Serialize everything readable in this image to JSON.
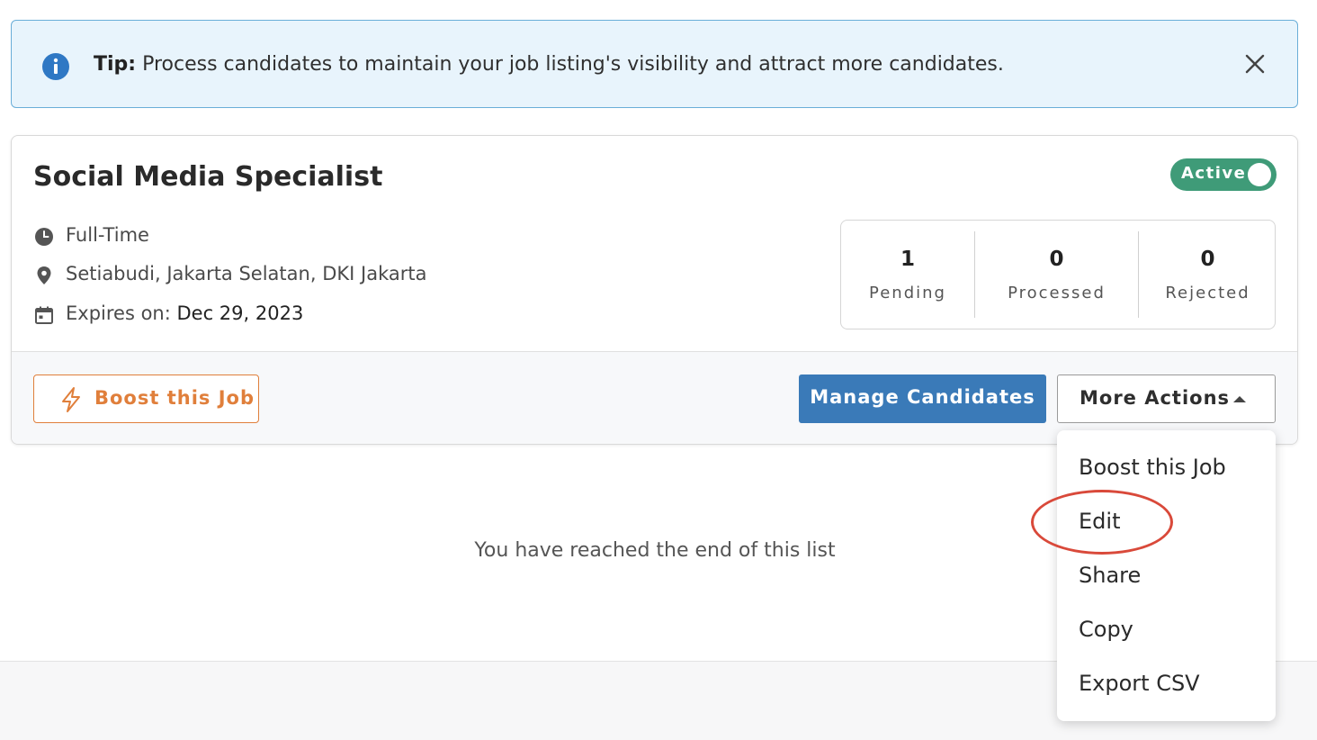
{
  "tip": {
    "bold": "Tip:",
    "text": " Process candidates to maintain your job listing's visibility and attract more candidates."
  },
  "job": {
    "title": "Social Media Specialist",
    "status": "Active",
    "status_on": true,
    "employment_type": "Full-Time",
    "location": "Setiabudi, Jakarta Selatan, DKI Jakarta",
    "expires_label": "Expires on:",
    "expires_value": "Dec 29, 2023"
  },
  "stats": [
    {
      "value": "1",
      "label": "Pending"
    },
    {
      "value": "0",
      "label": "Processed"
    },
    {
      "value": "0",
      "label": "Rejected"
    }
  ],
  "actions": {
    "boost_label": "Boost this Job",
    "manage_label": "Manage Candidates",
    "more_label": "More Actions"
  },
  "menu": {
    "items": [
      {
        "label": "Boost this Job"
      },
      {
        "label": "Edit"
      },
      {
        "label": "Share"
      },
      {
        "label": "Copy"
      },
      {
        "label": "Export CSV"
      }
    ]
  },
  "end_message": "You have reached the end of this list",
  "colors": {
    "tip_bg": "#e8f4fc",
    "tip_border": "#6aaed8",
    "info_icon": "#2f78c4",
    "active_green": "#3f9b78",
    "boost_orange": "#e07f3b",
    "manage_blue": "#3a7ab8",
    "highlight_red": "#d9493a"
  },
  "icons": {
    "info": "info-icon",
    "close": "close-icon",
    "clock": "clock-icon",
    "location": "location-pin-icon",
    "calendar": "calendar-icon",
    "bolt": "lightning-bolt-icon",
    "caret": "caret-up-icon"
  }
}
